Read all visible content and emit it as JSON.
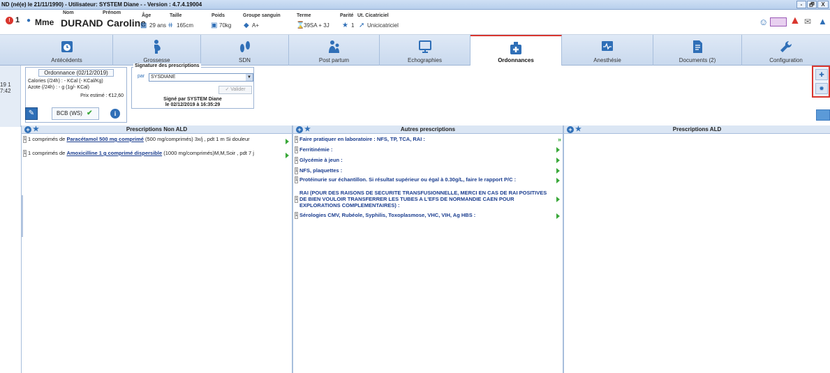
{
  "window": {
    "title": "ND (né(e) le 21/11/1990) - Utilisateur: SYSTEM Diane - - Version : 4.7.4.19004",
    "controls": [
      "-",
      "🗗",
      "X"
    ]
  },
  "patient": {
    "alert_count": "1",
    "headers": {
      "nom": "Nom",
      "prenom": "Prénom",
      "age": "Âge",
      "taille": "Taille",
      "poids": "Poids",
      "groupe": "Groupe sanguin",
      "terme": "Terme",
      "parite": "Parité",
      "ut": "Ut. Cicatriciel"
    },
    "civility": "Mme",
    "last_name": "DURAND",
    "first_name": "Caroline",
    "age": "29 ans",
    "height": "165cm",
    "weight": "70kg",
    "blood_group": "A+",
    "term": "39SA + 3J",
    "parity": "1",
    "uterus": "Unicicatriciel"
  },
  "tabs": [
    {
      "label": "Antécédents",
      "icon": "calendar-clock-icon"
    },
    {
      "label": "Grossesse",
      "icon": "pregnancy-icon"
    },
    {
      "label": "SDN",
      "icon": "footprints-icon"
    },
    {
      "label": "Post partum",
      "icon": "mother-baby-icon"
    },
    {
      "label": "Echographies",
      "icon": "monitor-icon"
    },
    {
      "label": "Ordonnances",
      "icon": "medical-cross-icon"
    },
    {
      "label": "Anesthésie",
      "icon": "anesthesia-monitor-icon"
    },
    {
      "label": "Documents (2)",
      "icon": "documents-icon"
    },
    {
      "label": "Configuration",
      "icon": "wrench-icon"
    }
  ],
  "active_tab": "Ordonnances",
  "left_strip": [
    "19 1",
    "7:42"
  ],
  "ordonnance": {
    "title": "Ordonnance (02/12/2019)",
    "calories": "Calories (/24h) : - KCal (- KCal/Kg)",
    "azote": "Azote (/24h) : - g (1g/- KCal)",
    "price": "Prix estimé : €12,60"
  },
  "signature": {
    "header": "Signature des prescriptions",
    "par_label": "par",
    "signer": "SYSDIANE",
    "validate_label": "Valider",
    "signed_line1": "Signé par SYSTEM Diane",
    "signed_line2": "le 02/12/2019 à 16:35:29"
  },
  "bcb_label": "BCB (WS)",
  "columns": {
    "non_ald": {
      "title": "Prescriptions Non ALD",
      "items": [
        {
          "qty": "1",
          "pre": "1 comprimés de ",
          "drug": "Paracétamol 500 mg comprimé",
          "post": " (500 mg/comprimés) 3x/j , pdt 1 m Si douleur"
        },
        {
          "qty": "1",
          "pre": "1 comprimés de ",
          "drug": "Amoxicilline 1 g comprimé dispersible",
          "post": " (1000 mg/comprimés)M,M,Soir , pdt 7 j"
        }
      ]
    },
    "autres": {
      "title": "Autres prescriptions",
      "items": [
        {
          "qty": "1",
          "text": "Faire pratiquer en laboratoire : NFS, TP, TCA, RAI :",
          "double": true
        },
        {
          "qty": "1",
          "text": "Ferritinémie :"
        },
        {
          "qty": "1",
          "text": "Glycémie à jeun :"
        },
        {
          "qty": "1",
          "text": "NFS, plaquettes :"
        },
        {
          "qty": "1",
          "text": "Protéinurie sur échantillon. Si résultat supérieur ou égal à 0.30g/L, faire le rapport P/C :"
        },
        {
          "qty": "1",
          "text": "RAI        (POUR DES RAISONS DE SECURITE TRANSFUSIONNELLE, MERCI EN CAS DE RAI POSITIVES DE BIEN VOULOIR TRANSFERRER LES TUBES A L'EFS DE NORMANDIE CAEN POUR EXPLORATIONS COMPLEMENTAIRES) :"
        },
        {
          "qty": "1",
          "text": "Sérologies CMV, Rubéole, Syphilis, Toxoplasmose, VHC, VIH, Ag HBS :"
        }
      ]
    },
    "ald": {
      "title": "Prescriptions ALD",
      "items": []
    }
  }
}
